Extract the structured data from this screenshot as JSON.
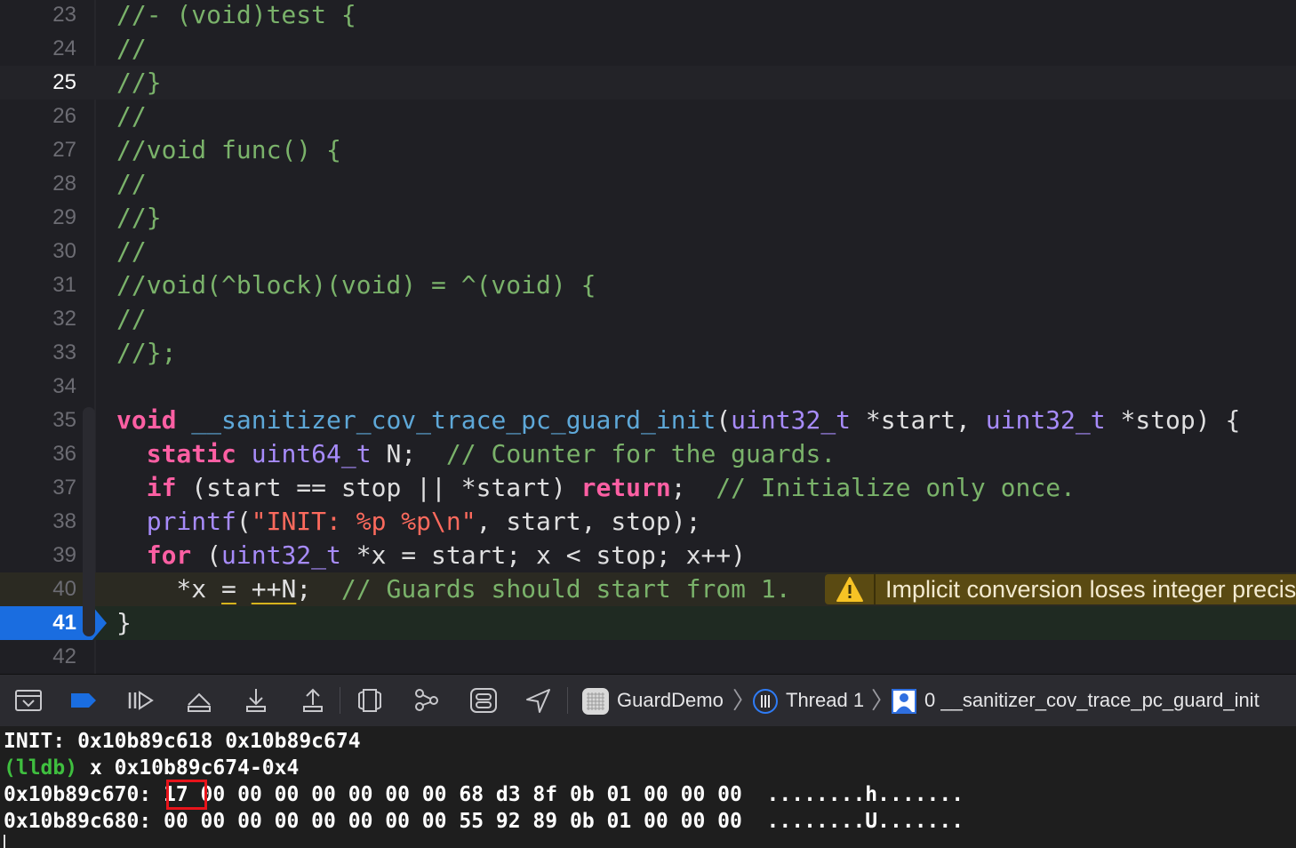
{
  "editor": {
    "current_line": "25",
    "pc_line": "41",
    "warning_line": "40",
    "lines": [
      {
        "n": "23",
        "tokens": [
          {
            "t": "//- (void)test {",
            "c": "c"
          }
        ]
      },
      {
        "n": "24",
        "tokens": [
          {
            "t": "//",
            "c": "c"
          }
        ]
      },
      {
        "n": "25",
        "tokens": [
          {
            "t": "//}",
            "c": "c"
          }
        ]
      },
      {
        "n": "26",
        "tokens": [
          {
            "t": "//",
            "c": "c"
          }
        ]
      },
      {
        "n": "27",
        "tokens": [
          {
            "t": "//void func() {",
            "c": "c"
          }
        ]
      },
      {
        "n": "28",
        "tokens": [
          {
            "t": "//",
            "c": "c"
          }
        ]
      },
      {
        "n": "29",
        "tokens": [
          {
            "t": "//}",
            "c": "c"
          }
        ]
      },
      {
        "n": "30",
        "tokens": [
          {
            "t": "//",
            "c": "c"
          }
        ]
      },
      {
        "n": "31",
        "tokens": [
          {
            "t": "//void(^block)(void) = ^(void) {",
            "c": "c"
          }
        ]
      },
      {
        "n": "32",
        "tokens": [
          {
            "t": "//",
            "c": "c"
          }
        ]
      },
      {
        "n": "33",
        "tokens": [
          {
            "t": "//};",
            "c": "c"
          }
        ]
      },
      {
        "n": "34",
        "tokens": []
      },
      {
        "n": "35",
        "tokens": [
          {
            "t": "void",
            "c": "k"
          },
          {
            "t": " ",
            "c": ""
          },
          {
            "t": "__sanitizer_cov_trace_pc_guard_init",
            "c": "f"
          },
          {
            "t": "(",
            "c": ""
          },
          {
            "t": "uint32_t",
            "c": "t"
          },
          {
            "t": " *start, ",
            "c": ""
          },
          {
            "t": "uint32_t",
            "c": "t"
          },
          {
            "t": " *stop) {",
            "c": ""
          }
        ]
      },
      {
        "n": "36",
        "tokens": [
          {
            "t": "  ",
            "c": ""
          },
          {
            "t": "static",
            "c": "k"
          },
          {
            "t": " ",
            "c": ""
          },
          {
            "t": "uint64_t",
            "c": "t"
          },
          {
            "t": " N;  ",
            "c": ""
          },
          {
            "t": "// Counter for the guards.",
            "c": "c"
          }
        ]
      },
      {
        "n": "37",
        "tokens": [
          {
            "t": "  ",
            "c": ""
          },
          {
            "t": "if",
            "c": "k"
          },
          {
            "t": " (start == stop || *start) ",
            "c": ""
          },
          {
            "t": "return",
            "c": "k"
          },
          {
            "t": ";  ",
            "c": ""
          },
          {
            "t": "// Initialize only once.",
            "c": "c"
          }
        ]
      },
      {
        "n": "38",
        "tokens": [
          {
            "t": "  ",
            "c": ""
          },
          {
            "t": "printf",
            "c": "t"
          },
          {
            "t": "(",
            "c": ""
          },
          {
            "t": "\"INIT: %p %p\\n\"",
            "c": "s"
          },
          {
            "t": ", start, stop);",
            "c": ""
          }
        ]
      },
      {
        "n": "39",
        "tokens": [
          {
            "t": "  ",
            "c": ""
          },
          {
            "t": "for",
            "c": "k"
          },
          {
            "t": " (",
            "c": ""
          },
          {
            "t": "uint32_t",
            "c": "t"
          },
          {
            "t": " *x = start; x < stop; x++)",
            "c": ""
          }
        ]
      },
      {
        "n": "40",
        "tokens": [
          {
            "t": "    *x ",
            "c": ""
          },
          {
            "t": "=",
            "c": "u"
          },
          {
            "t": " ",
            "c": ""
          },
          {
            "t": "++N",
            "c": "u"
          },
          {
            "t": ";  ",
            "c": ""
          },
          {
            "t": "// Guards should start from 1.",
            "c": "c"
          }
        ]
      },
      {
        "n": "41",
        "tokens": [
          {
            "t": "}",
            "c": ""
          }
        ]
      },
      {
        "n": "42",
        "tokens": []
      }
    ],
    "warning": {
      "icon": "warning-triangle-icon",
      "text": "Implicit conversion loses integer precision"
    }
  },
  "debug_bar": {
    "buttons": [
      {
        "name": "hide-debug-area-button",
        "icon": "hide-debug-area-icon"
      },
      {
        "name": "breakpoints-toggle-button",
        "icon": "breakpoint-icon"
      },
      {
        "name": "continue-button",
        "icon": "continue-icon"
      },
      {
        "name": "step-over-button",
        "icon": "step-over-icon"
      },
      {
        "name": "step-into-button",
        "icon": "step-into-icon"
      },
      {
        "name": "step-out-button",
        "icon": "step-out-icon"
      },
      {
        "name": "view-hierarchy-button",
        "icon": "view-hierarchy-icon"
      },
      {
        "name": "memory-graph-button",
        "icon": "memory-graph-icon"
      },
      {
        "name": "environment-overrides-button",
        "icon": "environment-overrides-icon"
      },
      {
        "name": "simulate-location-button",
        "icon": "location-icon"
      }
    ],
    "breadcrumb": {
      "app": "GuardDemo",
      "thread": "Thread 1",
      "frame": "0 __sanitizer_cov_trace_pc_guard_init"
    }
  },
  "console": {
    "lines": [
      {
        "prompt": "",
        "text": "INIT: 0x10b89c618 0x10b89c674"
      },
      {
        "prompt": "(lldb)",
        "text": " x 0x10b89c674-0x4"
      },
      {
        "prompt": "",
        "text": "0x10b89c670: 17 00 00 00 00 00 00 00 68 d3 8f 0b 01 00 00 00  ........h......."
      },
      {
        "prompt": "",
        "text": "0x10b89c680: 00 00 00 00 00 00 00 00 55 92 89 0b 01 00 00 00  ........U......."
      }
    ],
    "highlighted_byte": "17",
    "colors": {
      "prompt": "#3fbf3f",
      "highlight_box": "#e8141b"
    }
  },
  "colors": {
    "editor_bg": "#1f1f24",
    "comment": "#7ab26a",
    "keyword": "#fc5fa3",
    "type": "#a78bfa",
    "function": "#5ea8d8",
    "string": "#fc6a5d",
    "pc_marker": "#1a6de0",
    "warning_badge": "#5a4a12"
  }
}
